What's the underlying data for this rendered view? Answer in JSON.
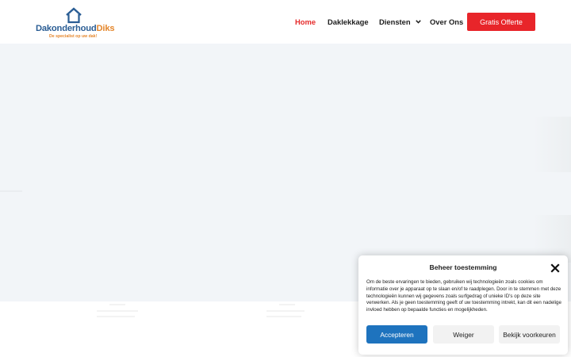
{
  "header": {
    "logo": {
      "name_part1": "Dakonderhoud",
      "name_part2": "Diks",
      "tagline": "De specialist op uw dak!",
      "colors": {
        "blue": "#2a5d94",
        "orange": "#e4872d"
      },
      "icon": "house-icon"
    },
    "nav": [
      {
        "label": "Home",
        "active": true
      },
      {
        "label": "Daklekkage",
        "active": false
      },
      {
        "label": "Diensten",
        "active": false,
        "dropdown": true
      },
      {
        "label": "Over Ons",
        "active": false
      }
    ],
    "cta_label": "Gratis Offerte",
    "colors": {
      "active": "#e52b2b",
      "cta_bg": "#e8252a"
    }
  },
  "consent": {
    "title": "Beheer toestemming",
    "text": "Om de beste ervaringen te bieden, gebruiken wij technologieën zoals cookies om informatie over je apparaat op te slaan en/of te raadplegen. Door in te stemmen met deze technologieën kunnen wij gegevens zoals surfgedrag of unieke ID's op deze site verwerken. Als je geen toestemming geeft of uw toestemming intrekt, kan dit een nadelige invloed hebben op bepaalde functies en mogelijkheden.",
    "accept_label": "Accepteren",
    "deny_label": "Weiger",
    "preferences_label": "Bekijk voorkeuren",
    "colors": {
      "accept_bg": "#1e73be"
    }
  }
}
